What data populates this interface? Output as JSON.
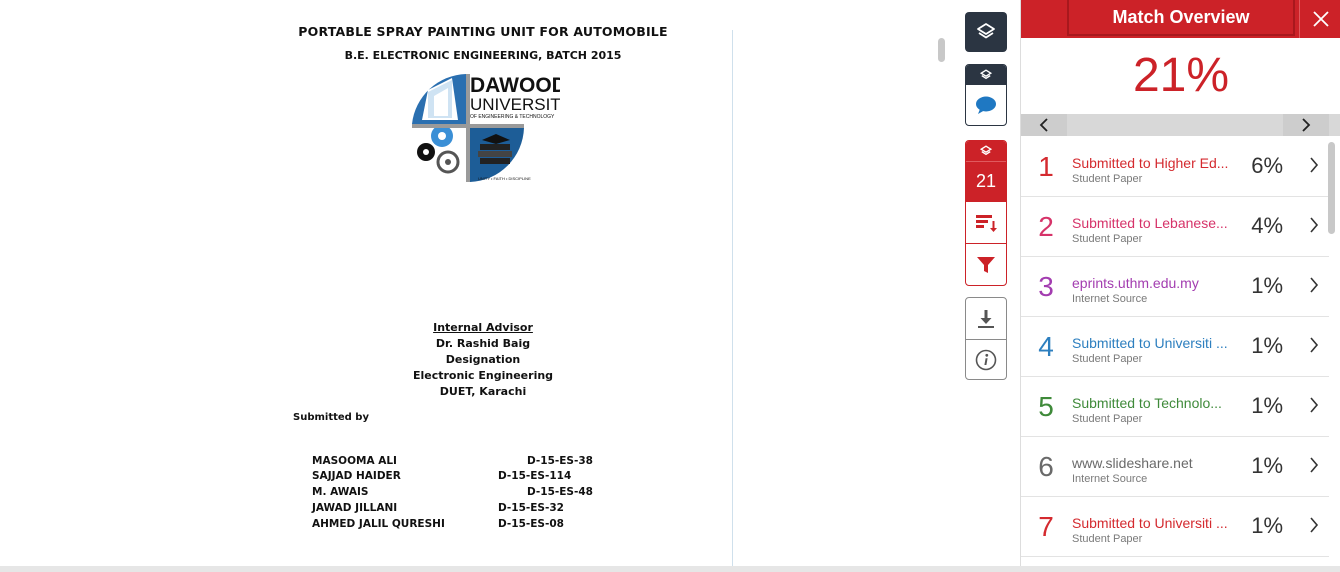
{
  "document": {
    "title": "PORTABLE SPRAY PAINTING UNIT FOR AUTOMOBILE",
    "subtitle": "B.E. ELECTRONIC ENGINEERING, BATCH 2015",
    "logo": {
      "name_line1": "DAWOOD",
      "name_line2": "UNIVERSITY",
      "name_line3": "OF ENGINEERING & TECHNOLOGY",
      "motto": "UNITY • FAITH • DISCIPLINE"
    },
    "advisor": {
      "heading": "Internal Advisor",
      "name": "Dr. Rashid Baig",
      "designation": "Designation",
      "department": "Electronic Engineering",
      "institute": "DUET, Karachi"
    },
    "submitted_by_label": "Submitted by",
    "students": [
      {
        "name": "MASOOMA ALI",
        "id": "D-15-ES-38"
      },
      {
        "name": "SAJJAD HAIDER",
        "id": "D-15-ES-114"
      },
      {
        "name": "M. AWAIS",
        "id": "D-15-ES-48"
      },
      {
        "name": "JAWAD JILLANI",
        "id": "D-15-ES-32"
      },
      {
        "name": "AHMED JALIL QURESHI",
        "id": "D-15-ES-08"
      }
    ]
  },
  "toolbar": {
    "match_count": "21",
    "icons": [
      "layers-icon",
      "comment-icon",
      "sort-icon",
      "filter-icon",
      "download-icon",
      "info-icon"
    ]
  },
  "panel": {
    "title": "Match Overview",
    "overall_percent": "21%",
    "matches": [
      {
        "num": "1",
        "source": "Submitted to Higher Ed...",
        "type": "Student Paper",
        "percent": "6%",
        "color": "#d42a2f"
      },
      {
        "num": "2",
        "source": "Submitted to Lebanese...",
        "type": "Student Paper",
        "percent": "4%",
        "color": "#d63369"
      },
      {
        "num": "3",
        "source": "eprints.uthm.edu.my",
        "type": "Internet Source",
        "percent": "1%",
        "color": "#a33db0"
      },
      {
        "num": "4",
        "source": "Submitted to Universiti ...",
        "type": "Student Paper",
        "percent": "1%",
        "color": "#2d7fbf"
      },
      {
        "num": "5",
        "source": "Submitted to Technolo...",
        "type": "Student Paper",
        "percent": "1%",
        "color": "#3f8a3a"
      },
      {
        "num": "6",
        "source": "www.slideshare.net",
        "type": "Internet Source",
        "percent": "1%",
        "color": "#6a6a6a"
      },
      {
        "num": "7",
        "source": "Submitted to Universiti ...",
        "type": "Student Paper",
        "percent": "1%",
        "color": "#d42a2f"
      }
    ]
  },
  "colors": {
    "accent": "#cc2228",
    "toolbar_dark": "#2b3542"
  }
}
